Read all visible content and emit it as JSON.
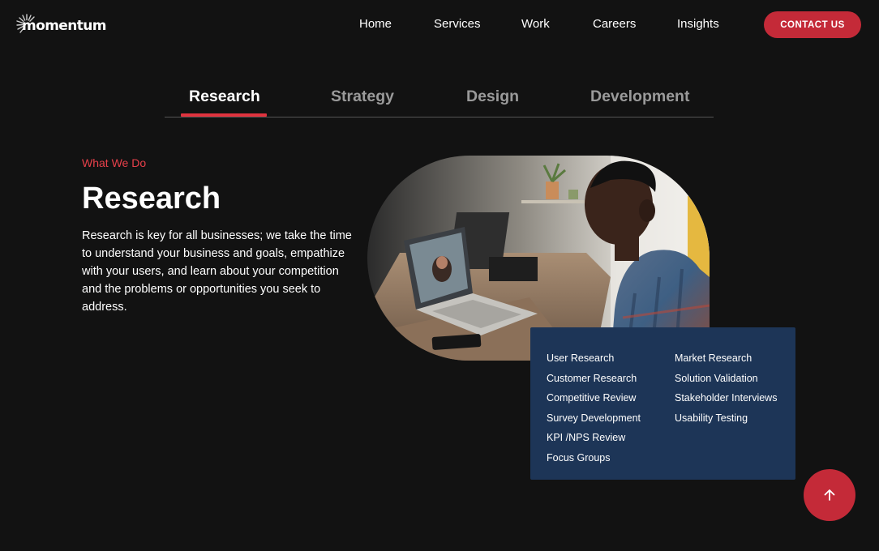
{
  "brand": {
    "name": "momentum"
  },
  "nav": {
    "items": [
      {
        "label": "Home"
      },
      {
        "label": "Services"
      },
      {
        "label": "Work"
      },
      {
        "label": "Careers"
      },
      {
        "label": "Insights"
      }
    ],
    "contact_label": "CONTACT US"
  },
  "tabs": [
    {
      "label": "Research",
      "active": true
    },
    {
      "label": "Strategy",
      "active": false
    },
    {
      "label": "Design",
      "active": false
    },
    {
      "label": "Development",
      "active": false
    }
  ],
  "section": {
    "eyebrow": "What We Do",
    "heading": "Research",
    "body": "Research is key for all businesses; we take the time to understand your business and goals, empathize with your users, and learn about your competition and the problems or opportunities you seek to address."
  },
  "services": {
    "left": [
      "User Research",
      "Customer Research",
      "Competitive Review",
      "Survey Development",
      "KPI /NPS Review",
      "Focus Groups"
    ],
    "right": [
      "Market Research",
      "Solution Validation",
      "Stakeholder Interviews",
      "Usability Testing"
    ]
  },
  "colors": {
    "background": "#121212",
    "accent": "#c42a38",
    "eyebrow": "#e7404a",
    "card": "#1d3557"
  },
  "icons": {
    "back_to_top": "arrow-up-icon",
    "logo_mark": "sunburst-logo-icon"
  }
}
